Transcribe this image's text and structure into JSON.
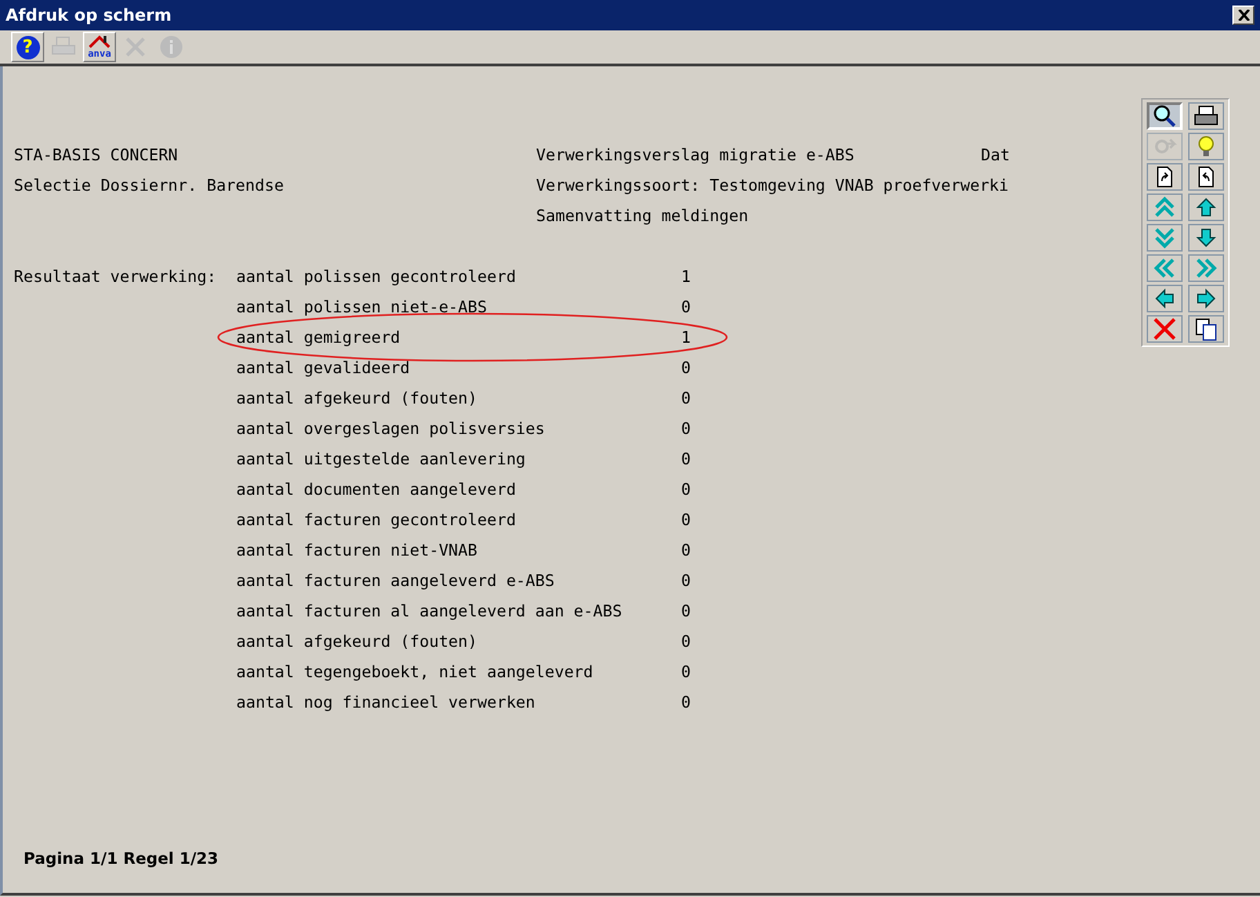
{
  "window": {
    "title": "Afdruk op scherm"
  },
  "toolbar": [
    {
      "kind": "help",
      "symbol": "?",
      "disabled": false
    },
    {
      "kind": "print",
      "disabled": true
    },
    {
      "kind": "anva",
      "label": "anva",
      "disabled": false
    },
    {
      "kind": "cancel",
      "disabled": true
    },
    {
      "kind": "info",
      "disabled": true
    }
  ],
  "report": {
    "header_left": [
      "STA-BASIS CONCERN",
      "Selectie Dossiernr. Barendse"
    ],
    "header_right": [
      "Verwerkingsverslag migratie e-ABS",
      "Verwerkingssoort: Testomgeving VNAB proefverwerki",
      "Samenvatting meldingen"
    ],
    "header_far_right": "Dat",
    "section_label": "Resultaat verwerking:",
    "rows": [
      {
        "label": "aantal polissen gecontroleerd",
        "value": "1",
        "highlighted": false
      },
      {
        "label": "aantal polissen niet-e-ABS",
        "value": "0",
        "highlighted": false
      },
      {
        "label": "aantal gemigreerd",
        "value": "1",
        "highlighted": true
      },
      {
        "label": "aantal gevalideerd",
        "value": "0",
        "highlighted": false
      },
      {
        "label": "aantal afgekeurd (fouten)",
        "value": "0",
        "highlighted": false
      },
      {
        "label": "aantal overgeslagen polisversies",
        "value": "0",
        "highlighted": false
      },
      {
        "label": "aantal uitgestelde aanlevering",
        "value": "0",
        "highlighted": false
      },
      {
        "label": "aantal documenten aangeleverd",
        "value": "0",
        "highlighted": false
      },
      {
        "label": "aantal facturen gecontroleerd",
        "value": "0",
        "highlighted": false
      },
      {
        "label": "aantal facturen niet-VNAB",
        "value": "0",
        "highlighted": false
      },
      {
        "label": "aantal facturen aangeleverd e-ABS",
        "value": "0",
        "highlighted": false
      },
      {
        "label": "aantal facturen al aangeleverd aan e-ABS",
        "value": "0",
        "highlighted": false
      },
      {
        "label": "aantal afgekeurd (fouten)",
        "value": "0",
        "highlighted": false
      },
      {
        "label": "aantal tegengeboekt, niet aangeleverd",
        "value": "0",
        "highlighted": false
      },
      {
        "label": "aantal nog financieel verwerken",
        "value": "0",
        "highlighted": false
      }
    ]
  },
  "palette": [
    {
      "kind": "zoom",
      "selected": true,
      "disabled": false
    },
    {
      "kind": "print",
      "selected": false,
      "disabled": false
    },
    {
      "kind": "redo",
      "selected": false,
      "disabled": true
    },
    {
      "kind": "bulb",
      "selected": false,
      "disabled": false
    },
    {
      "kind": "page-next",
      "selected": false,
      "disabled": false
    },
    {
      "kind": "page-prev",
      "selected": false,
      "disabled": false
    },
    {
      "kind": "double-up",
      "selected": false,
      "disabled": false
    },
    {
      "kind": "up",
      "selected": false,
      "disabled": false
    },
    {
      "kind": "double-down",
      "selected": false,
      "disabled": false
    },
    {
      "kind": "down",
      "selected": false,
      "disabled": false
    },
    {
      "kind": "double-left",
      "selected": false,
      "disabled": false
    },
    {
      "kind": "double-right",
      "selected": false,
      "disabled": false
    },
    {
      "kind": "left",
      "selected": false,
      "disabled": false
    },
    {
      "kind": "right",
      "selected": false,
      "disabled": false
    },
    {
      "kind": "close",
      "selected": false,
      "disabled": false
    },
    {
      "kind": "copy",
      "selected": false,
      "disabled": false
    }
  ],
  "status": "Pagina 1/1  Regel 1/23"
}
